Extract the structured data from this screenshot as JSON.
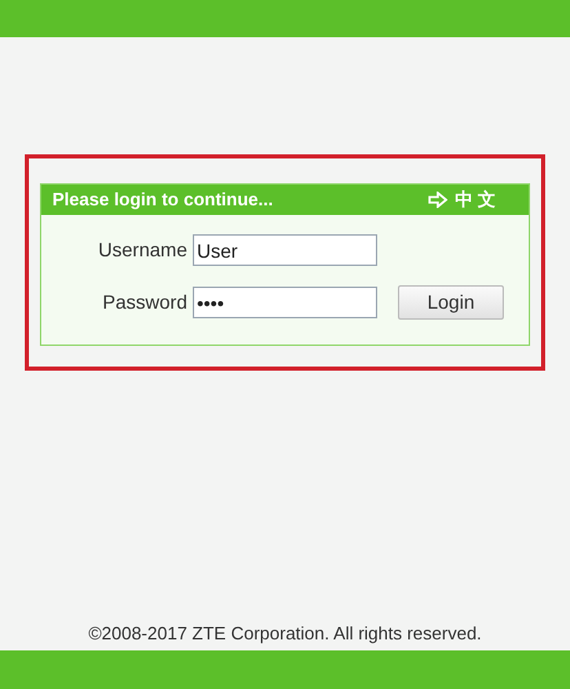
{
  "login_panel": {
    "title": "Please login to continue...",
    "language_link": "中 文",
    "username": {
      "label": "Username",
      "value": "User"
    },
    "password": {
      "label": "Password",
      "value": "••••"
    },
    "login_button": "Login"
  },
  "footer": {
    "copyright": "©2008-2017 ZTE Corporation. All rights reserved."
  }
}
